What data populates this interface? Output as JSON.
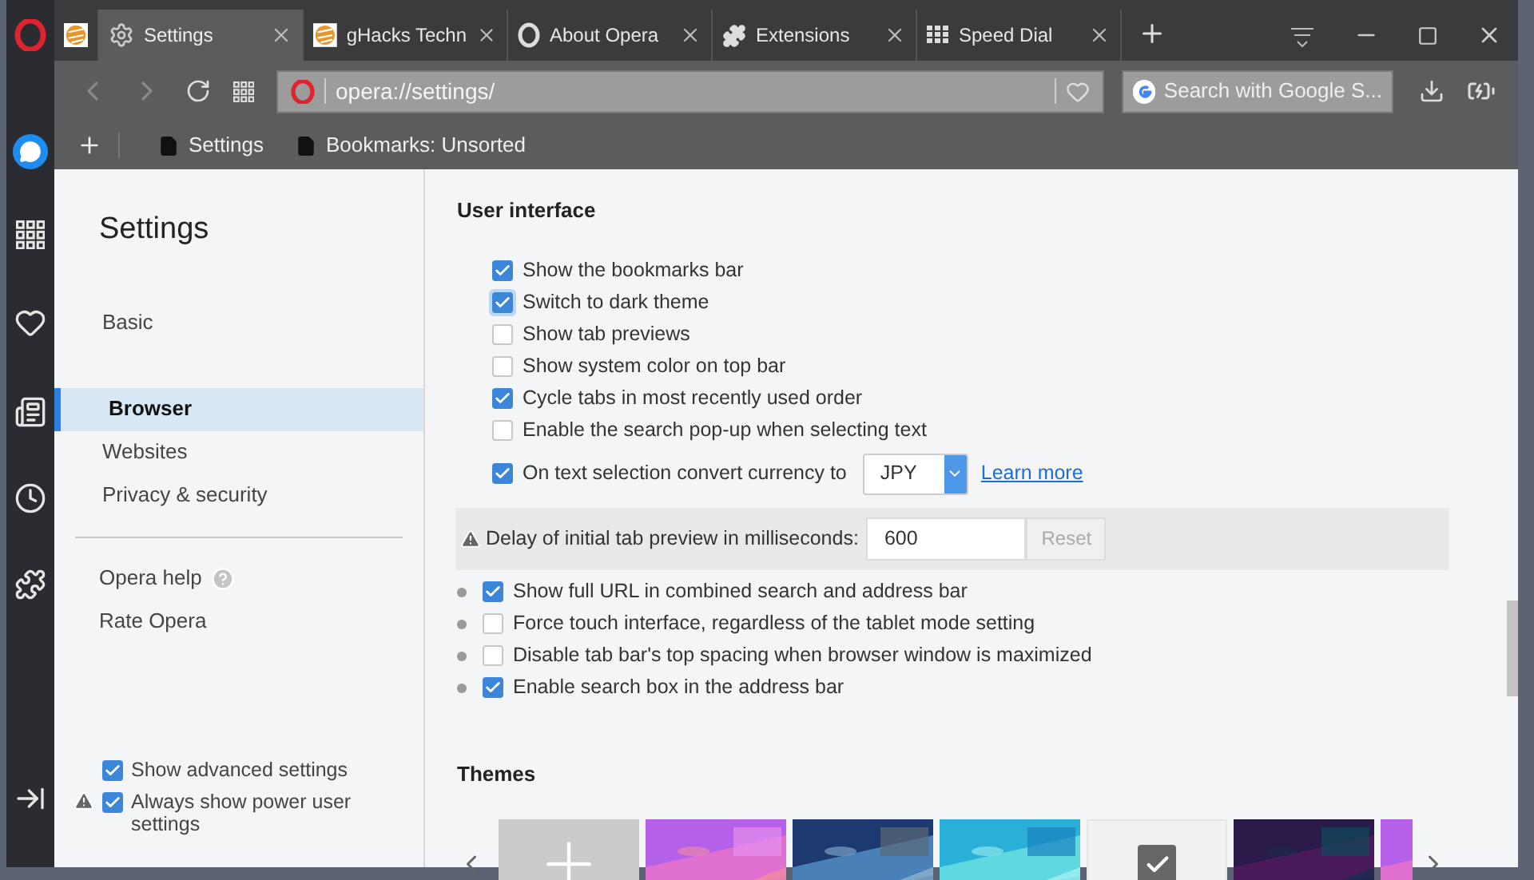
{
  "tabs": [
    {
      "kind": "pinned",
      "selected": false
    },
    {
      "kind": "gear",
      "title": "Settings",
      "selected": true
    },
    {
      "kind": "site",
      "title": "gHacks Techn",
      "selected": false
    },
    {
      "kind": "opera",
      "title": "About Opera",
      "selected": false
    },
    {
      "kind": "puzzle",
      "title": "Extensions",
      "selected": false
    },
    {
      "kind": "grid",
      "title": "Speed Dial",
      "selected": false
    }
  ],
  "address_bar": {
    "value": "opera://settings/"
  },
  "search": {
    "placeholder": "Search with Google S..."
  },
  "bookmarks": [
    {
      "label": "Settings"
    },
    {
      "label": "Bookmarks: Unsorted"
    }
  ],
  "nav": {
    "title": "Settings",
    "items": [
      {
        "label": "Basic",
        "selected": false,
        "kind": "top"
      },
      {
        "label": "Browser",
        "selected": true,
        "kind": "group"
      },
      {
        "label": "Websites",
        "selected": false,
        "kind": "group"
      },
      {
        "label": "Privacy & security",
        "selected": false,
        "kind": "group"
      }
    ],
    "links": [
      {
        "label": "Opera help",
        "help": true
      },
      {
        "label": "Rate Opera",
        "help": false
      }
    ],
    "options": [
      {
        "label": "Show advanced settings",
        "checked": true,
        "warning": false
      },
      {
        "label": "Always show power user settings",
        "checked": true,
        "warning": true
      }
    ]
  },
  "section": {
    "title": "User interface",
    "options": [
      {
        "kind": "checkbox",
        "label": "Show the bookmarks bar",
        "checked": true,
        "focused": false
      },
      {
        "kind": "checkbox",
        "label": "Switch to dark theme",
        "checked": true,
        "focused": true
      },
      {
        "kind": "checkbox",
        "label": "Show tab previews",
        "checked": false,
        "focused": false
      },
      {
        "kind": "checkbox",
        "label": "Show system color on top bar",
        "checked": false,
        "focused": false
      },
      {
        "kind": "checkbox",
        "label": "Cycle tabs in most recently used order",
        "checked": true,
        "focused": false
      },
      {
        "kind": "checkbox",
        "label": "Enable the search pop-up when selecting text",
        "checked": false,
        "focused": false
      },
      {
        "kind": "currency",
        "label": "On text selection convert currency to",
        "checked": true,
        "focused": false,
        "value": "JPY",
        "link": "Learn more"
      },
      {
        "kind": "delay",
        "label": "Delay of initial tab preview in milliseconds:",
        "value": "600",
        "button": "Reset"
      },
      {
        "kind": "power",
        "label": "Show full URL in combined search and address bar",
        "checked": true,
        "focused": false
      },
      {
        "kind": "power",
        "label": "Force touch interface, regardless of the tablet mode setting",
        "checked": false,
        "focused": false
      },
      {
        "kind": "power",
        "label": "Disable tab bar's top spacing when browser window is maximized",
        "checked": false,
        "focused": false
      },
      {
        "kind": "power",
        "label": "Enable search box in the address bar",
        "checked": true,
        "focused": false
      }
    ]
  },
  "themes": {
    "title": "Themes",
    "items": [
      {
        "kind": "add",
        "selected": false
      },
      {
        "kind": "picture",
        "selected": false
      },
      {
        "kind": "picture",
        "selected": false
      },
      {
        "kind": "picture",
        "selected": false
      },
      {
        "kind": "plain",
        "selected": true
      },
      {
        "kind": "picture",
        "selected": false
      },
      {
        "kind": "picture",
        "selected": false
      }
    ]
  }
}
